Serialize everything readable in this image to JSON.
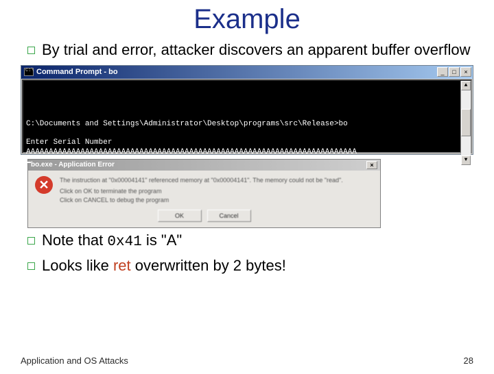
{
  "title": "Example",
  "bullets": {
    "b1": "By trial and error, attacker discovers an apparent buffer overflow",
    "b2_pre": "Note that ",
    "b2_code": "0x41",
    "b2_post": " is \"A\"",
    "b3_pre": "Looks like ",
    "b3_ret": "ret",
    "b3_post": " overwritten by 2 bytes!"
  },
  "cmd": {
    "title": "Command Prompt - bo",
    "min": "_",
    "max": "□",
    "close": "×",
    "up": "▲",
    "down": "▼",
    "line1": "C:\\Documents and Settings\\Administrator\\Desktop\\programs\\src\\Release>bo",
    "line2": "",
    "line3": "Enter Serial Number",
    "line4": "AAAAAAAAAAAAAAAAAAAAAAAAAAAAAAAAAAAAAAAAAAAAAAAAAAAAAAAAAAAAAAAAAAAAAAAAA"
  },
  "err": {
    "title": "bo.exe - Application Error",
    "close": "×",
    "icon": "✕",
    "msg1": "The instruction at \"0x00004141\" referenced memory at \"0x00004141\". The memory could not be \"read\".",
    "msg2": "Click on OK to terminate the program",
    "msg3": "Click on CANCEL to debug the program",
    "ok": "OK",
    "cancel": "Cancel"
  },
  "footer": {
    "left": "Application and OS Attacks",
    "right": "28"
  }
}
